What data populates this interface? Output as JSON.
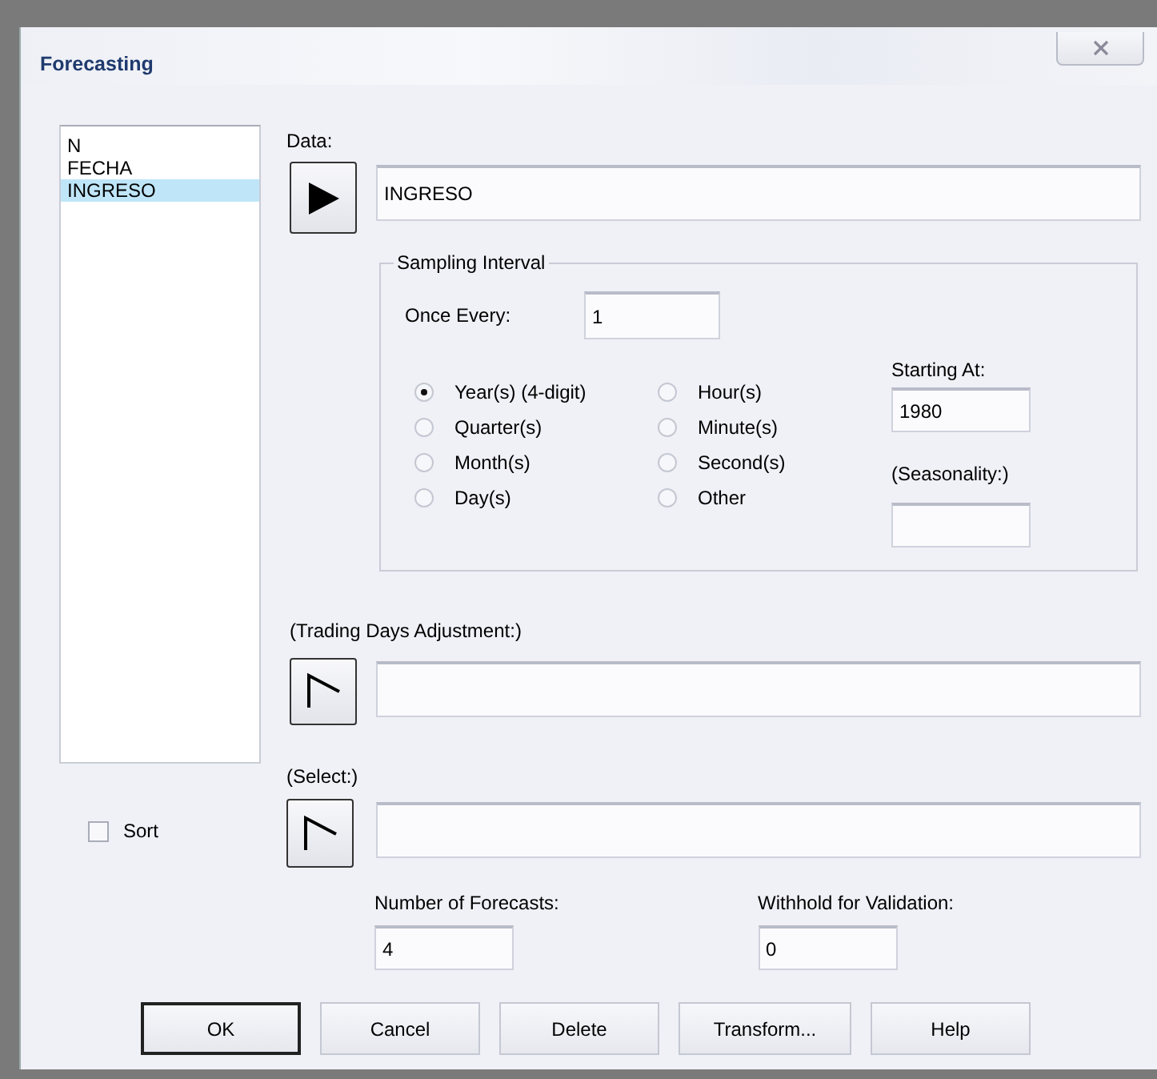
{
  "window": {
    "title": "Forecasting"
  },
  "variables": [
    {
      "label": "N",
      "selected": false
    },
    {
      "label": "FECHA",
      "selected": false
    },
    {
      "label": "INGRESO",
      "selected": true
    }
  ],
  "sort": {
    "label": "Sort",
    "checked": false
  },
  "data": {
    "label": "Data:",
    "value": "INGRESO",
    "kind": "solid"
  },
  "sampling_interval": {
    "title": "Sampling Interval",
    "once_every": {
      "label": "Once Every:",
      "value": "1"
    },
    "units": [
      {
        "label": "Year(s) (4-digit)",
        "selected": true
      },
      {
        "label": "Quarter(s)",
        "selected": false
      },
      {
        "label": "Month(s)",
        "selected": false
      },
      {
        "label": "Day(s)",
        "selected": false
      },
      {
        "label": "Hour(s)",
        "selected": false
      },
      {
        "label": "Minute(s)",
        "selected": false
      },
      {
        "label": "Second(s)",
        "selected": false
      },
      {
        "label": "Other",
        "selected": false
      }
    ],
    "starting_at": {
      "label": "Starting At:",
      "value": "1980"
    },
    "seasonality": {
      "label": "(Seasonality:)"
    }
  },
  "trading_days": {
    "label": "(Trading Days Adjustment:)",
    "kind": "hollow"
  },
  "select": {
    "label": "(Select:)",
    "kind": "hollow"
  },
  "number_of_forecasts": {
    "label": "Number of Forecasts:",
    "value": "4"
  },
  "withhold": {
    "label": "Withhold for Validation:",
    "value": "0"
  },
  "buttons": [
    {
      "label": "OK",
      "default": true
    },
    {
      "label": "Cancel",
      "default": false
    },
    {
      "label": "Delete",
      "default": false
    },
    {
      "label": "Transform...",
      "default": false
    },
    {
      "label": "Help",
      "default": false
    }
  ]
}
